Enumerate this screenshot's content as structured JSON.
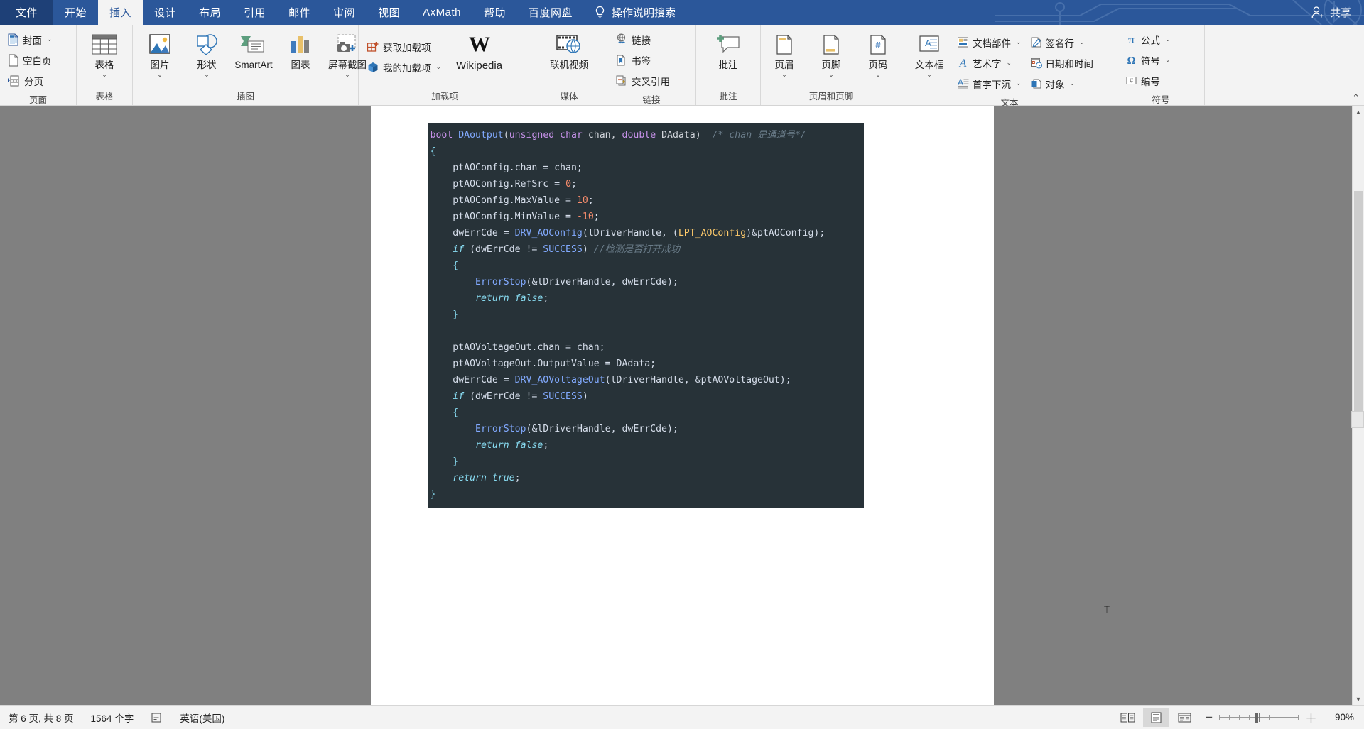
{
  "titlebar": {
    "tabs": [
      {
        "label": "文件",
        "kind": "file"
      },
      {
        "label": "开始",
        "kind": "normal"
      },
      {
        "label": "插入",
        "kind": "active"
      },
      {
        "label": "设计",
        "kind": "normal"
      },
      {
        "label": "布局",
        "kind": "normal"
      },
      {
        "label": "引用",
        "kind": "normal"
      },
      {
        "label": "邮件",
        "kind": "normal"
      },
      {
        "label": "审阅",
        "kind": "normal"
      },
      {
        "label": "视图",
        "kind": "normal"
      },
      {
        "label": "AxMath",
        "kind": "normal"
      },
      {
        "label": "帮助",
        "kind": "normal"
      },
      {
        "label": "百度网盘",
        "kind": "normal"
      }
    ],
    "tell_me": "操作说明搜索",
    "tell_me_icon": "lightbulb-icon",
    "share_label": "共享",
    "share_icon": "person-add-icon",
    "accent_color": "#2b579a",
    "file_tab_color": "#1e4077"
  },
  "ribbon": {
    "groups": [
      {
        "name": "页面",
        "label": "页面",
        "small_items": [
          {
            "label": "封面",
            "icon": "cover-page-icon",
            "caret": true
          },
          {
            "label": "空白页",
            "icon": "blank-page-icon",
            "caret": false
          },
          {
            "label": "分页",
            "icon": "page-break-icon",
            "caret": false
          }
        ]
      },
      {
        "name": "表格",
        "label": "表格",
        "big_items": [
          {
            "label": "表格",
            "icon": "table-icon",
            "caret": true
          }
        ]
      },
      {
        "name": "插图",
        "label": "插图",
        "big_items": [
          {
            "label": "图片",
            "icon": "picture-icon",
            "caret": true
          },
          {
            "label": "形状",
            "icon": "shapes-icon",
            "caret": true
          },
          {
            "label": "SmartArt",
            "icon": "smartart-icon",
            "caret": false
          },
          {
            "label": "图表",
            "icon": "chart-icon",
            "caret": false
          },
          {
            "label": "屏幕截图",
            "icon": "screenshot-icon",
            "caret": true
          }
        ]
      },
      {
        "name": "加载项",
        "label": "加载项",
        "small_items": [
          {
            "label": "获取加载项",
            "icon": "get-addins-icon",
            "caret": false
          },
          {
            "label": "我的加载项",
            "icon": "my-addins-icon",
            "caret": true
          }
        ],
        "big_items": [
          {
            "label": "Wikipedia",
            "icon": "wikipedia-icon",
            "caret": false
          }
        ]
      },
      {
        "name": "媒体",
        "label": "媒体",
        "big_items": [
          {
            "label": "联机视频",
            "icon": "online-video-icon",
            "caret": false
          }
        ]
      },
      {
        "name": "链接",
        "label": "链接",
        "small_items": [
          {
            "label": "链接",
            "icon": "link-icon",
            "caret": false
          },
          {
            "label": "书签",
            "icon": "bookmark-icon",
            "caret": false
          },
          {
            "label": "交叉引用",
            "icon": "cross-reference-icon",
            "caret": false
          }
        ]
      },
      {
        "name": "批注",
        "label": "批注",
        "big_items": [
          {
            "label": "批注",
            "icon": "new-comment-icon",
            "caret": false
          }
        ]
      },
      {
        "name": "页眉和页脚",
        "label": "页眉和页脚",
        "big_items": [
          {
            "label": "页眉",
            "icon": "header-icon",
            "caret": true
          },
          {
            "label": "页脚",
            "icon": "footer-icon",
            "caret": true
          },
          {
            "label": "页码",
            "icon": "page-number-icon",
            "caret": true
          }
        ]
      },
      {
        "name": "文本",
        "label": "文本",
        "big_items": [
          {
            "label": "文本框",
            "icon": "text-box-icon",
            "caret": true
          }
        ],
        "small_items": [
          {
            "label": "文档部件",
            "icon": "quick-parts-icon",
            "caret": true
          },
          {
            "label": "艺术字",
            "icon": "wordart-icon",
            "caret": true
          },
          {
            "label": "首字下沉",
            "icon": "drop-cap-icon",
            "caret": true
          }
        ],
        "small_items2": [
          {
            "label": "签名行",
            "icon": "signature-line-icon",
            "caret": true
          },
          {
            "label": "日期和时间",
            "icon": "date-time-icon",
            "caret": false
          },
          {
            "label": "对象",
            "icon": "object-icon",
            "caret": true
          }
        ]
      },
      {
        "name": "符号",
        "label": "符号",
        "small_items": [
          {
            "label": "公式",
            "icon": "equation-pi-icon",
            "caret": true
          },
          {
            "label": "符号",
            "icon": "symbol-omega-icon",
            "caret": true
          },
          {
            "label": "编号",
            "icon": "number-icon",
            "caret": false
          }
        ]
      }
    ],
    "collapse_icon": "collapse-ribbon-icon"
  },
  "document": {
    "code_lines": [
      [
        {
          "t": "bool",
          "c": "kw"
        },
        {
          "t": " ",
          "c": "pl"
        },
        {
          "t": "DAoutput",
          "c": "fn"
        },
        {
          "t": "(",
          "c": "pl"
        },
        {
          "t": "unsigned char",
          "c": "kw"
        },
        {
          "t": " chan, ",
          "c": "pl"
        },
        {
          "t": "double",
          "c": "kw"
        },
        {
          "t": " DAdata)",
          "c": "pl"
        },
        {
          "t": "  /* chan 是通道号*/",
          "c": "cm"
        }
      ],
      [
        {
          "t": "{",
          "c": "br"
        }
      ],
      [
        {
          "t": "    ptAOConfig.chan = chan;",
          "c": "mem"
        }
      ],
      [
        {
          "t": "    ptAOConfig.RefSrc = ",
          "c": "mem"
        },
        {
          "t": "0",
          "c": "num"
        },
        {
          "t": ";",
          "c": "mem"
        }
      ],
      [
        {
          "t": "    ptAOConfig.MaxValue = ",
          "c": "mem"
        },
        {
          "t": "10",
          "c": "num"
        },
        {
          "t": ";",
          "c": "mem"
        }
      ],
      [
        {
          "t": "    ptAOConfig.MinValue = ",
          "c": "mem"
        },
        {
          "t": "-10",
          "c": "num"
        },
        {
          "t": ";",
          "c": "mem"
        }
      ],
      [
        {
          "t": "    dwErrCde = ",
          "c": "mem"
        },
        {
          "t": "DRV_AOConfig",
          "c": "fn"
        },
        {
          "t": "(lDriverHandle, (",
          "c": "mem"
        },
        {
          "t": "LPT_AOConfig",
          "c": "ty"
        },
        {
          "t": ")&ptAOConfig);",
          "c": "mem"
        }
      ],
      [
        {
          "t": "    if",
          "c": "ctl"
        },
        {
          "t": " (dwErrCde != ",
          "c": "mem"
        },
        {
          "t": "SUCCESS",
          "c": "fn"
        },
        {
          "t": ")",
          "c": "mem"
        },
        {
          "t": " //检测是否打开成功",
          "c": "cm"
        }
      ],
      [
        {
          "t": "    {",
          "c": "br"
        }
      ],
      [
        {
          "t": "        ",
          "c": "mem"
        },
        {
          "t": "ErrorStop",
          "c": "fn"
        },
        {
          "t": "(&lDriverHandle, dwErrCde);",
          "c": "mem"
        }
      ],
      [
        {
          "t": "        ",
          "c": "mem"
        },
        {
          "t": "return",
          "c": "ctl"
        },
        {
          "t": " ",
          "c": "mem"
        },
        {
          "t": "false",
          "c": "ctl"
        },
        {
          "t": ";",
          "c": "mem"
        }
      ],
      [
        {
          "t": "    }",
          "c": "br"
        }
      ],
      [
        {
          "t": "",
          "c": "mem"
        }
      ],
      [
        {
          "t": "    ptAOVoltageOut.chan = chan;",
          "c": "mem"
        }
      ],
      [
        {
          "t": "    ptAOVoltageOut.OutputValue = DAdata;",
          "c": "mem"
        }
      ],
      [
        {
          "t": "    dwErrCde = ",
          "c": "mem"
        },
        {
          "t": "DRV_AOVoltageOut",
          "c": "fn"
        },
        {
          "t": "(lDriverHandle, &ptAOVoltageOut);",
          "c": "mem"
        }
      ],
      [
        {
          "t": "    if",
          "c": "ctl"
        },
        {
          "t": " (dwErrCde != ",
          "c": "mem"
        },
        {
          "t": "SUCCESS",
          "c": "fn"
        },
        {
          "t": ")",
          "c": "mem"
        }
      ],
      [
        {
          "t": "    {",
          "c": "br"
        }
      ],
      [
        {
          "t": "        ",
          "c": "mem"
        },
        {
          "t": "ErrorStop",
          "c": "fn"
        },
        {
          "t": "(&lDriverHandle, dwErrCde);",
          "c": "mem"
        }
      ],
      [
        {
          "t": "        ",
          "c": "mem"
        },
        {
          "t": "return",
          "c": "ctl"
        },
        {
          "t": " ",
          "c": "mem"
        },
        {
          "t": "false",
          "c": "ctl"
        },
        {
          "t": ";",
          "c": "mem"
        }
      ],
      [
        {
          "t": "    }",
          "c": "br"
        }
      ],
      [
        {
          "t": "    ",
          "c": "mem"
        },
        {
          "t": "return",
          "c": "ctl"
        },
        {
          "t": " ",
          "c": "mem"
        },
        {
          "t": "true",
          "c": "ctl"
        },
        {
          "t": ";",
          "c": "mem"
        }
      ],
      [
        {
          "t": "}",
          "c": "br"
        }
      ]
    ],
    "code_bg": "#273238"
  },
  "statusbar": {
    "page_info": "第 6 页, 共 8 页",
    "word_count": "1564 个字",
    "proofing_icon": "proofing-errors-icon",
    "language": "英语(美国)",
    "views": [
      {
        "name": "read-mode",
        "icon": "read-mode-icon",
        "selected": false
      },
      {
        "name": "print-layout",
        "icon": "print-layout-icon",
        "selected": true
      },
      {
        "name": "web-layout",
        "icon": "web-layout-icon",
        "selected": false
      }
    ],
    "zoom_out_icon": "zoom-out-icon",
    "zoom_in_icon": "zoom-in-icon",
    "zoom_value": "90%",
    "zoom_percent": 90
  }
}
